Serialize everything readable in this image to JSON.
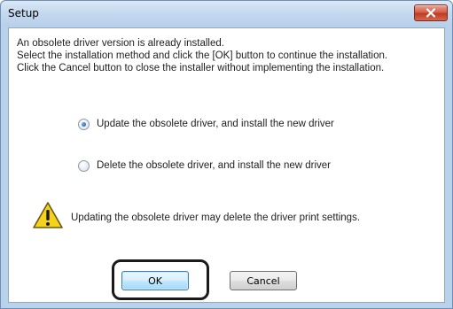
{
  "window": {
    "title": "Setup",
    "close_icon": "close-x-icon"
  },
  "message": {
    "line1": "An obsolete driver version is already installed.",
    "line2": "Select the installation method and click the [OK] button to continue the installation.",
    "line3": "Click the Cancel button to close the installer without implementing the installation."
  },
  "options": [
    {
      "label": "Update the obsolete driver, and install the new driver",
      "selected": true
    },
    {
      "label": "Delete the obsolete driver, and install the new driver",
      "selected": false
    }
  ],
  "warning": {
    "icon": "warning-triangle-icon",
    "text": "Updating the obsolete driver may delete the driver print settings."
  },
  "buttons": {
    "ok_label": "OK",
    "cancel_label": "Cancel"
  },
  "colors": {
    "highlight_frame": "#1a1a1a",
    "warning_yellow": "#f5d21c",
    "close_red": "#c23a22"
  }
}
